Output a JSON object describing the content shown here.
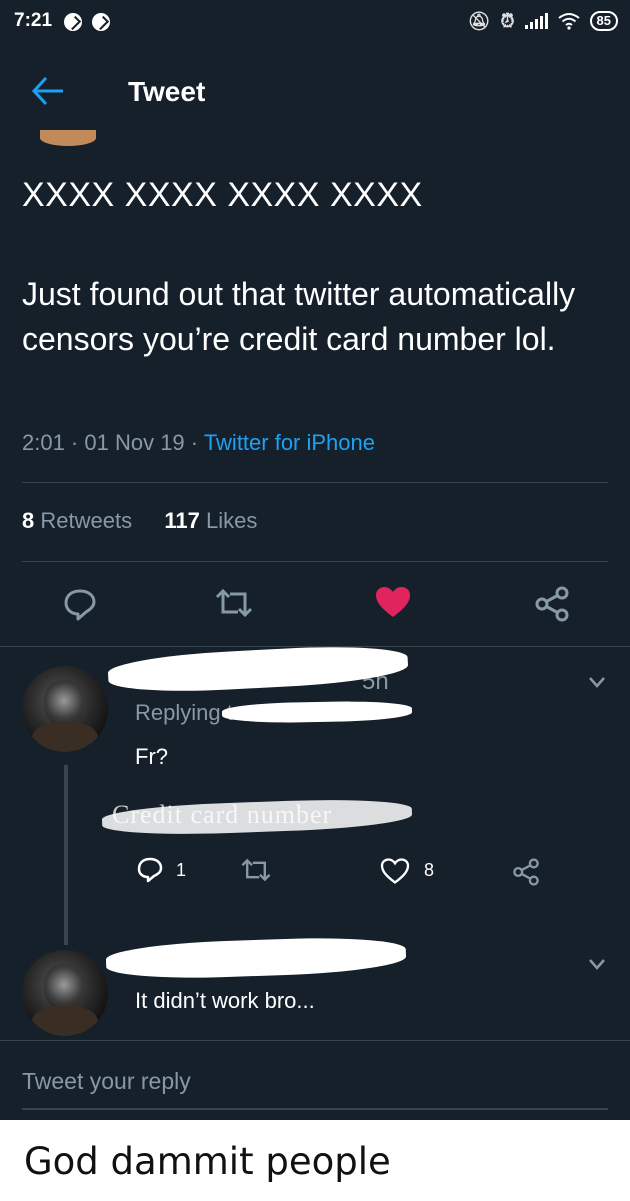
{
  "status_bar": {
    "time": "7:21",
    "battery": "85",
    "icons": [
      "messenger-icon",
      "messenger-icon",
      "mute-icon",
      "alarm-icon",
      "signal-icon",
      "wifi-icon",
      "battery-icon"
    ]
  },
  "header": {
    "title": "Tweet",
    "back_icon": "back-arrow-icon"
  },
  "tweet": {
    "name": "XXXX XXXX XXXX XXXX",
    "text": "Just found out that twitter automatically censors you’re credit card number lol.",
    "time": "2:01 · 01 Nov 19 · ",
    "source": "Twitter for iPhone",
    "retweets_count": "8",
    "retweets_label": "Retweets",
    "likes_count": "117",
    "likes_label": "Likes",
    "liked": true
  },
  "replies": [
    {
      "time_fragment": "5h",
      "replying_prefix": "Replying to",
      "text": "Fr?",
      "quoted_fragment": "Credit card number",
      "reply_count": "1",
      "like_count": "8"
    },
    {
      "text": "It didn’t work bro..."
    }
  ],
  "composer": {
    "placeholder": "Tweet your reply"
  },
  "caption": "God dammit people",
  "colors": {
    "background": "#15202b",
    "accent": "#1da1f2",
    "like": "#e0245e",
    "muted": "#8899a6",
    "divider": "#38444d"
  }
}
